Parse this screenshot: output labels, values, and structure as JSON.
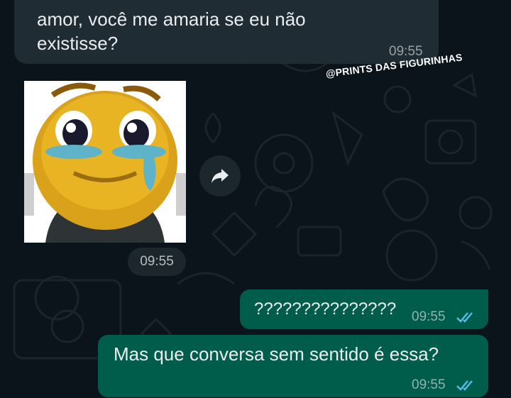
{
  "messages": [
    {
      "direction": "incoming",
      "text": "amor, você me amaria se eu não\nexistisse?",
      "time": "09:55"
    },
    {
      "direction": "incoming",
      "type": "sticker",
      "sticker": "crying-smiley-sticker",
      "time": "09:55"
    },
    {
      "direction": "outgoing",
      "text": "???????????????",
      "time": "09:55",
      "status": "read"
    },
    {
      "direction": "outgoing",
      "text": "Mas que conversa sem sentido é essa?",
      "time": "09:55",
      "status": "read"
    }
  ],
  "watermark": "@PRINTS DAS FIGURINHAS",
  "icons": {
    "forward": "forward-arrow-icon",
    "read_receipt": "double-check-icon"
  },
  "colors": {
    "background": "#0b141a",
    "incoming_bubble": "#1f2c33",
    "outgoing_bubble": "#005c4b",
    "read_ticks": "#53bdeb",
    "text": "#e9edef"
  }
}
